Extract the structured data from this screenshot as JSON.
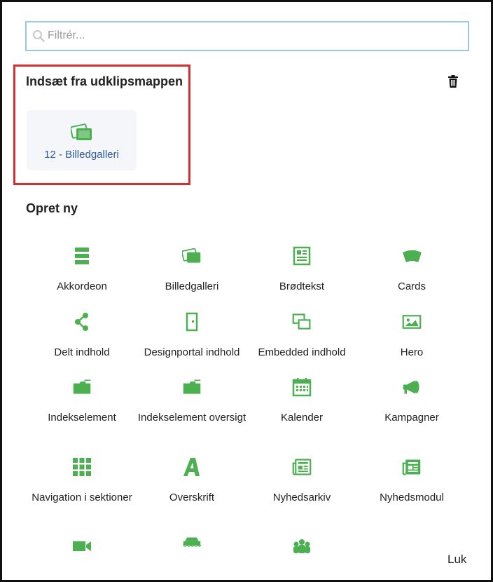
{
  "search": {
    "placeholder": "Filtrér..."
  },
  "clipboard": {
    "title": "Indsæt fra udklipsmappen",
    "item_label": "12 - Billedgalleri"
  },
  "create": {
    "title": "Opret ny",
    "items": [
      {
        "label": "Akkordeon",
        "icon": "accordion-icon"
      },
      {
        "label": "Billedgalleri",
        "icon": "gallery-icon"
      },
      {
        "label": "Brødtekst",
        "icon": "text-block-icon"
      },
      {
        "label": "Cards",
        "icon": "cards-icon"
      },
      {
        "label": "Delt indhold",
        "icon": "share-icon"
      },
      {
        "label": "Designportal indhold",
        "icon": "door-icon"
      },
      {
        "label": "Embedded indhold",
        "icon": "embed-icon"
      },
      {
        "label": "Hero",
        "icon": "image-icon"
      },
      {
        "label": "Indekselement",
        "icon": "folder-icon"
      },
      {
        "label": "Indekselement oversigt",
        "icon": "folders-icon"
      },
      {
        "label": "Kalender",
        "icon": "calendar-icon"
      },
      {
        "label": "Kampagner",
        "icon": "megaphone-icon"
      },
      {
        "label": "Navigation i sektioner",
        "icon": "grid-icon"
      },
      {
        "label": "Overskrift",
        "icon": "font-a-icon"
      },
      {
        "label": "Nyhedsarkiv",
        "icon": "newspaper-icon"
      },
      {
        "label": "Nyhedsmodul",
        "icon": "newspaper-icon"
      }
    ]
  },
  "footer": {
    "close_label": "Luk"
  },
  "colors": {
    "accent": "#4caf50",
    "link": "#2c5a9a",
    "highlight": "#d32f2f"
  }
}
